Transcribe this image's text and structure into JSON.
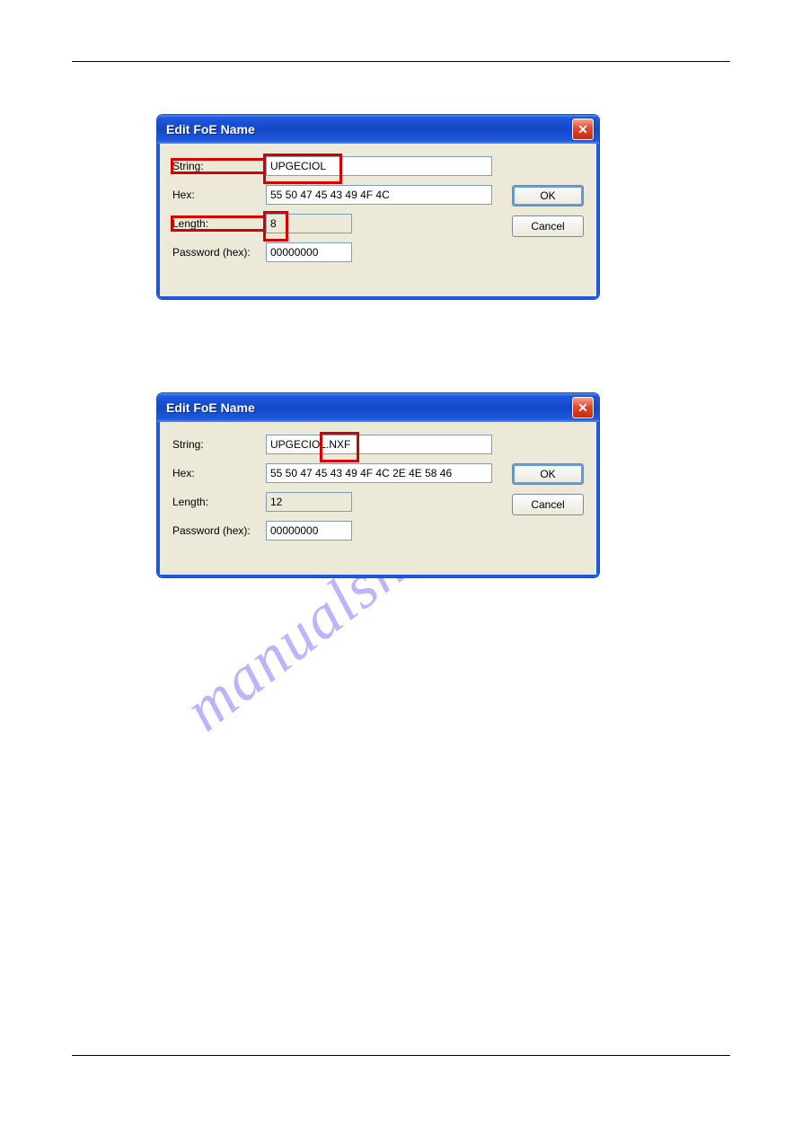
{
  "watermark_text": "manualshive.com",
  "dialog1": {
    "title": "Edit FoE Name",
    "labels": {
      "string": "String:",
      "hex": "Hex:",
      "length": "Length:",
      "password": "Password (hex):"
    },
    "values": {
      "string": "UPGECIOL",
      "hex": "55 50 47 45 43 49 4F 4C",
      "length": "8",
      "password": "00000000"
    },
    "buttons": {
      "ok": "OK",
      "cancel": "Cancel"
    }
  },
  "dialog2": {
    "title": "Edit FoE Name",
    "labels": {
      "string": "String:",
      "hex": "Hex:",
      "length": "Length:",
      "password": "Password (hex):"
    },
    "values": {
      "string": "UPGECIOL.NXF",
      "hex": "55 50 47 45 43 49 4F 4C 2E 4E 58 46",
      "length": "12",
      "password": "00000000"
    },
    "buttons": {
      "ok": "OK",
      "cancel": "Cancel"
    }
  }
}
